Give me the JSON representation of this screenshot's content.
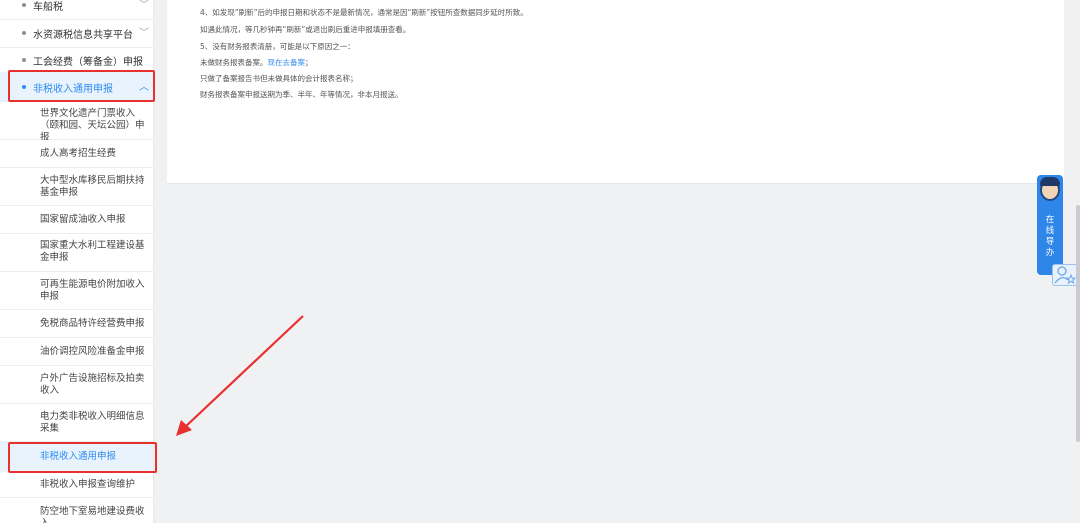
{
  "sidebar": {
    "top_items": [
      {
        "label": "车船税"
      },
      {
        "label": "水资源税信息共享平台"
      },
      {
        "label": "工会经费（筹备金）申报"
      },
      {
        "label": "非税收入通用申报"
      }
    ],
    "sub_items": [
      {
        "label": "世界文化遗产门票收入（颐和园、天坛公园）申报"
      },
      {
        "label": "成人高考招生经费"
      },
      {
        "label": "大中型水库移民后期扶持基金申报"
      },
      {
        "label": "国家留成油收入申报"
      },
      {
        "label": "国家重大水利工程建设基金申报"
      },
      {
        "label": "可再生能源电价附加收入申报"
      },
      {
        "label": "免税商品特许经营费申报"
      },
      {
        "label": "油价调控风险准备金申报"
      },
      {
        "label": "户外广告设施招标及拍卖收入"
      },
      {
        "label": "电力类非税收入明细信息采集"
      },
      {
        "label": "非税收入通用申报"
      },
      {
        "label": "非税收入申报查询维护"
      },
      {
        "label": "防空地下室易地建设费收入"
      }
    ]
  },
  "content": {
    "lines": [
      "4、如发现“刷新”后的申报日期和状态不是最新情况，通常是因“刷新”按钮所查数据同步延时所致。",
      "如遇此情况，等几秒钟再“刷新”或退出刷后重进申报填册查看。",
      "5、没有财务报表清册，可能是以下原因之一：",
      "只做了备案报告书但未做具体的会计报表名称；",
      "财务报表备案申报送期为季、半年、年等情况，非本月报送。"
    ],
    "unrecorded_prefix": "未做财务报表备案。",
    "unrecorded_link": "现在去备案",
    "unrecorded_suffix": "；"
  },
  "helper": {
    "text": "在线导办"
  },
  "colors": {
    "accent": "#2f8cf0",
    "highlight": "#e8302f"
  }
}
